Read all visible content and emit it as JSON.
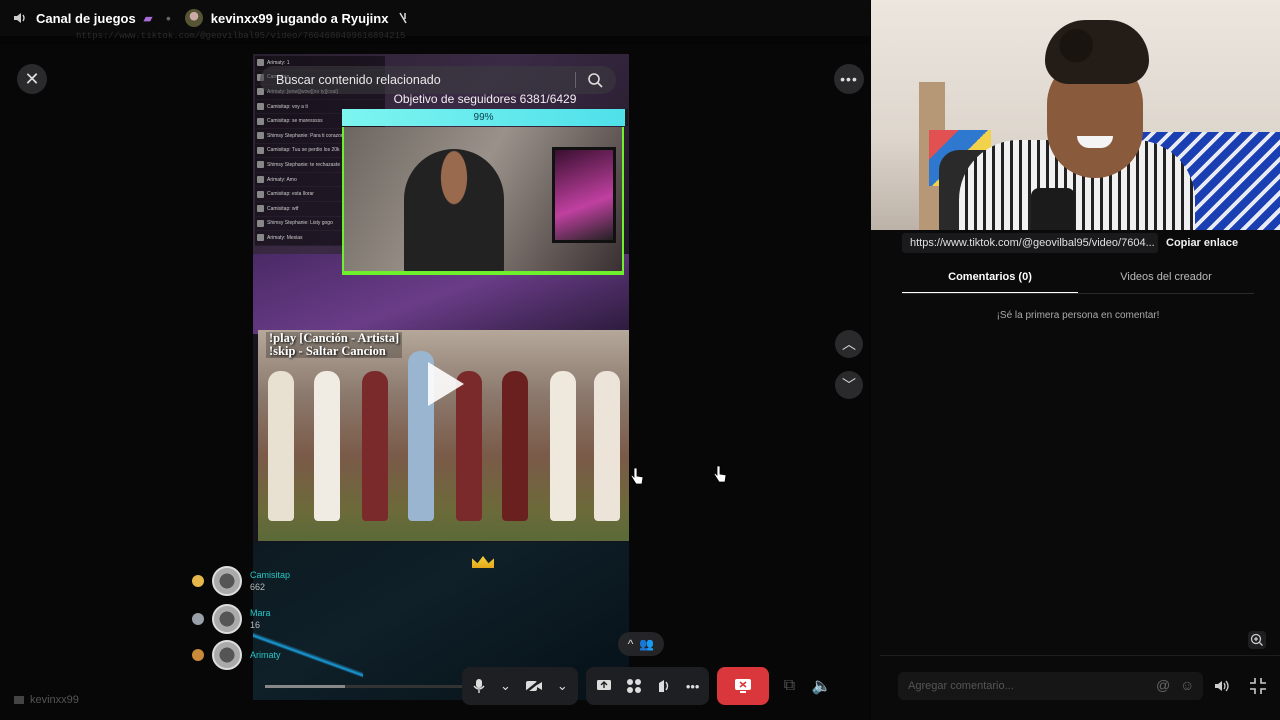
{
  "topbar": {
    "channel_name": "Canal de juegos",
    "stream_label": "kevinxx99 jugando a Ryujinx",
    "url_ghost": "https://www.tiktok.com/@geovilbal95/video/7604680499616894215"
  },
  "video": {
    "search_placeholder": "Buscar contenido relacionado",
    "follower_goal_label": "Objetivo de seguidores",
    "follower_goal_value": "6381/6429",
    "follower_goal_percent_label": "99%",
    "follower_goal_fraction": 0.99,
    "music_commands": [
      "!play [Canción - Artista]",
      "!skip - Saltar Cancion"
    ],
    "chat_lines": [
      "Arimaty: 1",
      "Camisitap",
      "Arimaty: [wow][wow][no ty][coal]",
      "Camisitap: voy a ti",
      "Camisitap: se maresssss",
      "Shimsy Stephanie: Para ti corazon",
      "Camisitap: Tuu se perdio los 20k",
      "Shimsy Stephanie: te rechazaste",
      "Arimaty: Amo",
      "Camisitap: esta llorar",
      "Camisitap: wtf",
      "Shimsy Stephanie: Listy gogo",
      "Arimaty: Mesias"
    ],
    "gifters": [
      {
        "name": "Camisitap",
        "count": "662"
      },
      {
        "name": "Mara",
        "count": "16"
      },
      {
        "name": "Arimaty",
        "count": ""
      }
    ],
    "playback_fraction": 0.4
  },
  "controls": {
    "mic_icon": "microphone-icon",
    "camera_icon": "camera-off-icon",
    "share_icon": "screen-share-icon",
    "activities_icon": "activities-icon",
    "soundboard_icon": "soundboard-icon",
    "more_icon": "more-icon",
    "end_call_icon": "end-stream-icon"
  },
  "bottom_left_user": "kevinxx99",
  "sidebar": {
    "link": "https://www.tiktok.com/@geovilbal95/video/7604...",
    "copy_label": "Copiar enlace",
    "tabs": [
      "Comentarios (0)",
      "Videos del creador"
    ],
    "active_tab": 0,
    "empty_message": "¡Sé la primera persona en comentar!",
    "comment_placeholder": "Agregar comentario..."
  },
  "colors": {
    "accent_teal": "#4fe0ea",
    "goal_green": "#6ef02c",
    "end_red": "#da373c"
  }
}
